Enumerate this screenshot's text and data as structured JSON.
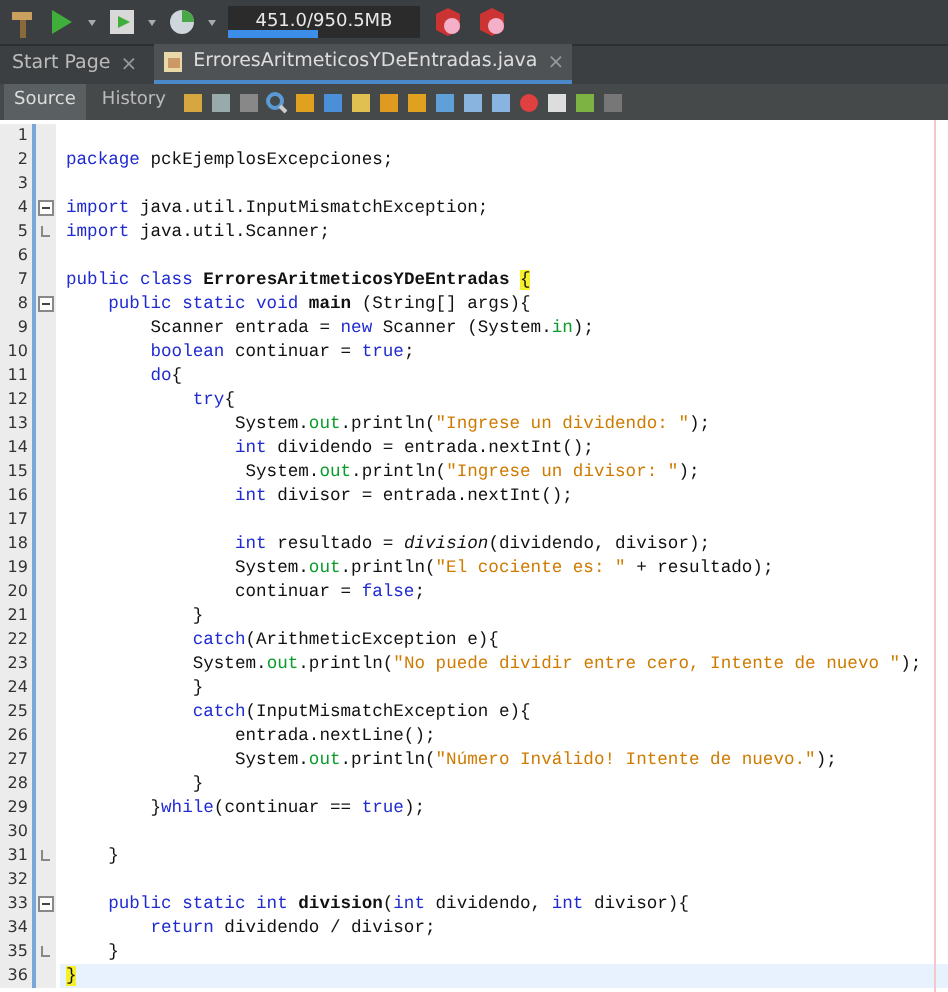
{
  "toolbar": {
    "memory": {
      "reading": "451.0/950.5MB",
      "level": 0.47
    }
  },
  "tabs": [
    {
      "label": "Start Page",
      "close": "×",
      "selected": false
    },
    {
      "label": "ErroresAritmeticosYDeEntradas.java",
      "close": "×",
      "selected": true
    }
  ],
  "editor_toolbar": {
    "views": [
      {
        "label": "Source",
        "selected": true
      },
      {
        "label": "History",
        "selected": false
      }
    ]
  },
  "code": {
    "lines": [
      {
        "number": "1"
      },
      {
        "number": "2",
        "tokens": [
          {
            "kind": "keyword",
            "text": "package "
          },
          {
            "kind": "plain",
            "text": "pckEjemplosExcepciones;"
          }
        ]
      },
      {
        "number": "3"
      },
      {
        "number": "4",
        "fold_start": true,
        "tokens": [
          {
            "kind": "keyword",
            "text": "import "
          },
          {
            "kind": "plain",
            "text": "java.util.InputMismatchException;"
          }
        ]
      },
      {
        "number": "5",
        "fold_end": true,
        "tokens": [
          {
            "kind": "keyword",
            "text": "import "
          },
          {
            "kind": "plain",
            "text": "java.util.Scanner;"
          }
        ]
      },
      {
        "number": "6"
      },
      {
        "number": "7",
        "tokens": [
          {
            "kind": "keyword",
            "text": "public class "
          },
          {
            "kind": "bold",
            "text": "ErroresAritmeticosYDeEntradas "
          },
          {
            "kind": "match",
            "text": "{"
          }
        ]
      },
      {
        "number": "8",
        "fold_start": true,
        "tokens": [
          {
            "kind": "keyword",
            "text": "    public static void "
          },
          {
            "kind": "bold",
            "text": "main"
          },
          {
            "kind": "plain",
            "text": " (String[] args){"
          }
        ]
      },
      {
        "number": "9",
        "tokens": [
          {
            "kind": "plain",
            "text": "        Scanner entrada = "
          },
          {
            "kind": "keyword",
            "text": "new"
          },
          {
            "kind": "plain",
            "text": " Scanner (System."
          },
          {
            "kind": "field",
            "text": "in"
          },
          {
            "kind": "plain",
            "text": ");"
          }
        ]
      },
      {
        "number": "10",
        "tokens": [
          {
            "kind": "keyword",
            "text": "        boolean"
          },
          {
            "kind": "plain",
            "text": " continuar = "
          },
          {
            "kind": "keyword",
            "text": "true"
          },
          {
            "kind": "plain",
            "text": ";"
          }
        ]
      },
      {
        "number": "11",
        "tokens": [
          {
            "kind": "keyword",
            "text": "        do"
          },
          {
            "kind": "plain",
            "text": "{"
          }
        ]
      },
      {
        "number": "12",
        "tokens": [
          {
            "kind": "keyword",
            "text": "            try"
          },
          {
            "kind": "plain",
            "text": "{"
          }
        ]
      },
      {
        "number": "13",
        "tokens": [
          {
            "kind": "plain",
            "text": "                System."
          },
          {
            "kind": "field",
            "text": "out"
          },
          {
            "kind": "plain",
            "text": ".println("
          },
          {
            "kind": "string",
            "text": "\"Ingrese un dividendo: \""
          },
          {
            "kind": "plain",
            "text": ");"
          }
        ]
      },
      {
        "number": "14",
        "tokens": [
          {
            "kind": "keyword",
            "text": "                int"
          },
          {
            "kind": "plain",
            "text": " dividendo = entrada.nextInt();"
          }
        ]
      },
      {
        "number": "15",
        "tokens": [
          {
            "kind": "plain",
            "text": "                 System."
          },
          {
            "kind": "field",
            "text": "out"
          },
          {
            "kind": "plain",
            "text": ".println("
          },
          {
            "kind": "string",
            "text": "\"Ingrese un divisor: \""
          },
          {
            "kind": "plain",
            "text": ");"
          }
        ]
      },
      {
        "number": "16",
        "tokens": [
          {
            "kind": "keyword",
            "text": "                int"
          },
          {
            "kind": "plain",
            "text": " divisor = entrada.nextInt();"
          }
        ]
      },
      {
        "number": "17"
      },
      {
        "number": "18",
        "tokens": [
          {
            "kind": "keyword",
            "text": "                int"
          },
          {
            "kind": "plain",
            "text": " resultado = "
          },
          {
            "kind": "italic",
            "text": "division"
          },
          {
            "kind": "plain",
            "text": "(dividendo, divisor);"
          }
        ]
      },
      {
        "number": "19",
        "tokens": [
          {
            "kind": "plain",
            "text": "                System."
          },
          {
            "kind": "field",
            "text": "out"
          },
          {
            "kind": "plain",
            "text": ".println("
          },
          {
            "kind": "string",
            "text": "\"El cociente es: \""
          },
          {
            "kind": "plain",
            "text": " + resultado);"
          }
        ]
      },
      {
        "number": "20",
        "tokens": [
          {
            "kind": "plain",
            "text": "                continuar = "
          },
          {
            "kind": "keyword",
            "text": "false"
          },
          {
            "kind": "plain",
            "text": ";"
          }
        ]
      },
      {
        "number": "21",
        "tokens": [
          {
            "kind": "plain",
            "text": "            }"
          }
        ]
      },
      {
        "number": "22",
        "tokens": [
          {
            "kind": "keyword",
            "text": "            catch"
          },
          {
            "kind": "plain",
            "text": "(ArithmeticException e){"
          }
        ]
      },
      {
        "number": "23",
        "tokens": [
          {
            "kind": "plain",
            "text": "            System."
          },
          {
            "kind": "field",
            "text": "out"
          },
          {
            "kind": "plain",
            "text": ".println("
          },
          {
            "kind": "string",
            "text": "\"No puede dividir entre cero, Intente de nuevo \""
          },
          {
            "kind": "plain",
            "text": ");"
          }
        ]
      },
      {
        "number": "24",
        "tokens": [
          {
            "kind": "plain",
            "text": "            }"
          }
        ]
      },
      {
        "number": "25",
        "tokens": [
          {
            "kind": "keyword",
            "text": "            catch"
          },
          {
            "kind": "plain",
            "text": "(InputMismatchException e){"
          }
        ]
      },
      {
        "number": "26",
        "tokens": [
          {
            "kind": "plain",
            "text": "                entrada.nextLine();"
          }
        ]
      },
      {
        "number": "27",
        "tokens": [
          {
            "kind": "plain",
            "text": "                System."
          },
          {
            "kind": "field",
            "text": "out"
          },
          {
            "kind": "plain",
            "text": ".println("
          },
          {
            "kind": "string",
            "text": "\"Número Inválido! Intente de nuevo.\""
          },
          {
            "kind": "plain",
            "text": ");"
          }
        ]
      },
      {
        "number": "28",
        "tokens": [
          {
            "kind": "plain",
            "text": "            }"
          }
        ]
      },
      {
        "number": "29",
        "tokens": [
          {
            "kind": "plain",
            "text": "        }"
          },
          {
            "kind": "keyword",
            "text": "while"
          },
          {
            "kind": "plain",
            "text": "(continuar == "
          },
          {
            "kind": "keyword",
            "text": "true"
          },
          {
            "kind": "plain",
            "text": ");"
          }
        ]
      },
      {
        "number": "30"
      },
      {
        "number": "31",
        "fold_end": true,
        "tokens": [
          {
            "kind": "plain",
            "text": "    }"
          }
        ]
      },
      {
        "number": "32"
      },
      {
        "number": "33",
        "fold_start": true,
        "tokens": [
          {
            "kind": "keyword",
            "text": "    public static int "
          },
          {
            "kind": "bold",
            "text": "division"
          },
          {
            "kind": "plain",
            "text": "("
          },
          {
            "kind": "keyword",
            "text": "int"
          },
          {
            "kind": "plain",
            "text": " dividendo, "
          },
          {
            "kind": "keyword",
            "text": "int"
          },
          {
            "kind": "plain",
            "text": " divisor){"
          }
        ]
      },
      {
        "number": "34",
        "tokens": [
          {
            "kind": "keyword",
            "text": "        return"
          },
          {
            "kind": "plain",
            "text": " dividendo / divisor;"
          }
        ]
      },
      {
        "number": "35",
        "fold_end": true,
        "tokens": [
          {
            "kind": "plain",
            "text": "    }"
          }
        ]
      },
      {
        "number": "36",
        "current": true,
        "tokens": [
          {
            "kind": "match",
            "text": "}"
          }
        ]
      }
    ]
  }
}
